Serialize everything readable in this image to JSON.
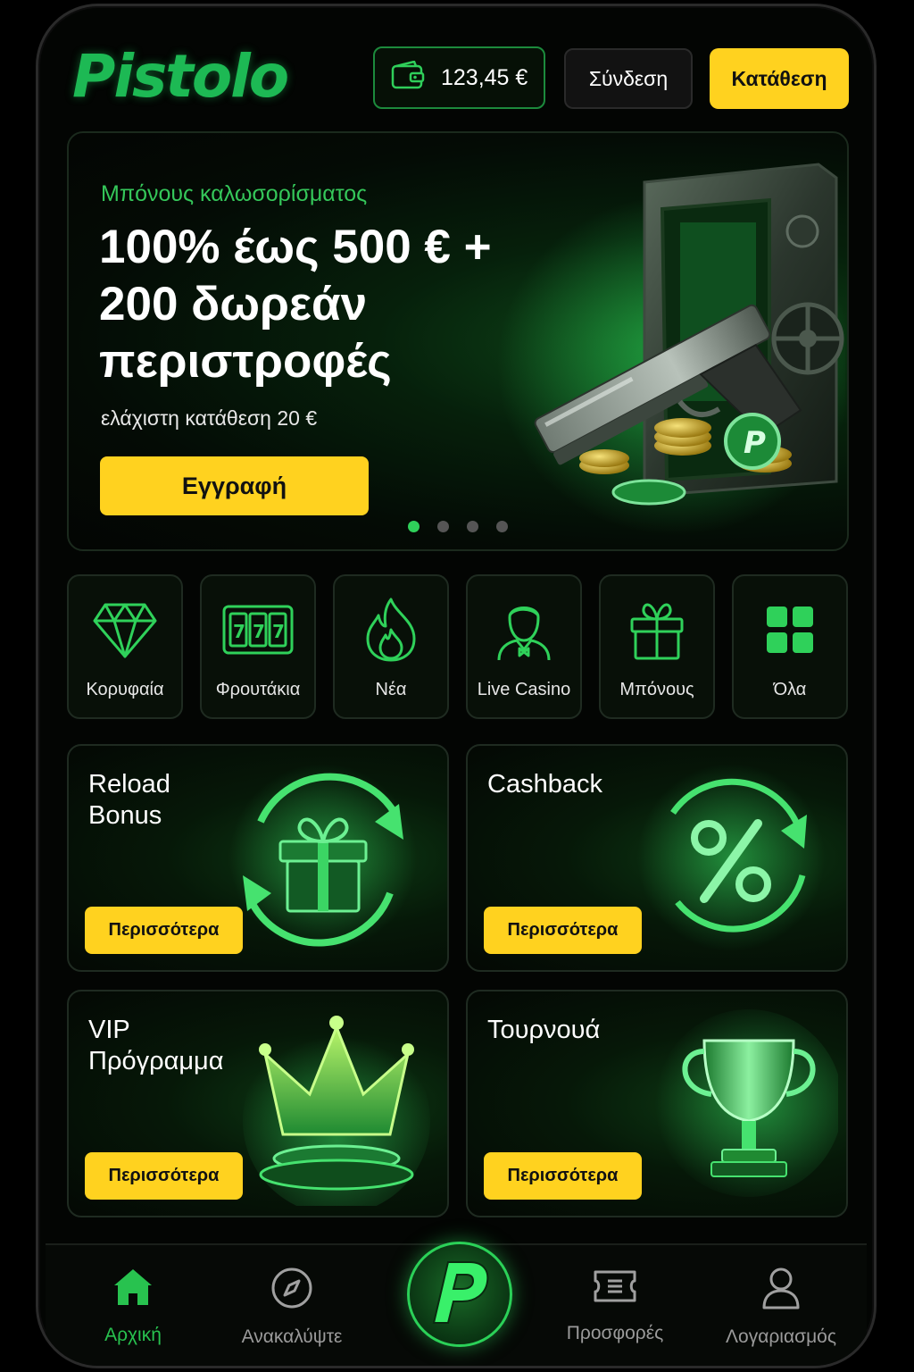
{
  "header": {
    "logo": "Pistolo",
    "balance": "123,45 €",
    "login_label": "Σύνδεση",
    "deposit_label": "Κατάθεση"
  },
  "hero": {
    "kicker": "Μπόνους καλωσορίσματος",
    "title": "100% έως 500 € + 200 δωρεάν περιστροφές",
    "subtitle": "ελάχιστη κατάθεση 20 €",
    "cta_label": "Εγγραφή",
    "carousel_total": 4,
    "carousel_active": 1
  },
  "categories": [
    {
      "label": "Κορυφαία",
      "icon": "diamond-icon"
    },
    {
      "label": "Φρουτάκια",
      "icon": "slot-machine-icon"
    },
    {
      "label": "Νέα",
      "icon": "flame-icon"
    },
    {
      "label": "Live Casino",
      "icon": "dealer-icon"
    },
    {
      "label": "Μπόνους",
      "icon": "gift-icon"
    },
    {
      "label": "Όλα",
      "icon": "grid-icon"
    }
  ],
  "promos": [
    {
      "title": "Reload\nBonus",
      "button": "Περισσότερα",
      "icon": "gift-refresh-icon"
    },
    {
      "title": "Cashback",
      "button": "Περισσότερα",
      "icon": "percent-refresh-icon"
    },
    {
      "title": "VIP\nΠρόγραμμα",
      "button": "Περισσότερα",
      "icon": "crown-icon"
    },
    {
      "title": "Τουρνουά",
      "button": "Περισσότερα",
      "icon": "trophy-icon"
    }
  ],
  "bottom_nav": {
    "home": "Αρχική",
    "discover": "Ανακαλύψτε",
    "offers": "Προσφορές",
    "account": "Λογαριασμός"
  },
  "colors": {
    "accent_green": "#1db954",
    "button_yellow": "#ffd21f",
    "background": "#030503"
  }
}
